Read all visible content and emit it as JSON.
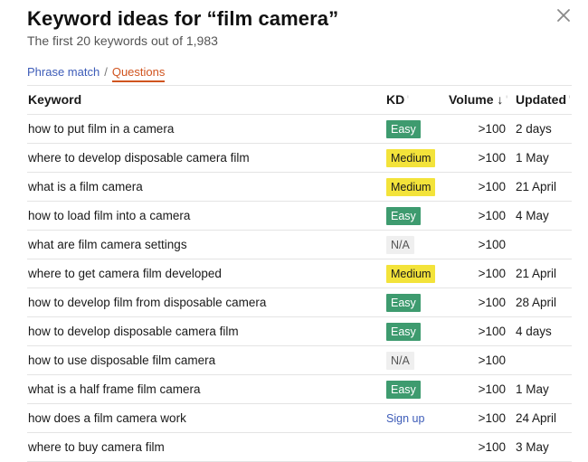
{
  "header": {
    "title": "Keyword ideas for “film camera”",
    "subtitle": "The first 20 keywords out of 1,983"
  },
  "tabs": [
    {
      "label": "Phrase match",
      "active": false
    },
    {
      "label": "Questions",
      "active": true
    }
  ],
  "tab_separator": "/",
  "columns": {
    "keyword": "Keyword",
    "kd": "KD",
    "volume": "Volume",
    "updated": "Updated",
    "info_glyph": "ⁱ",
    "sort_arrow": "↓"
  },
  "icons": {
    "close": "close-icon",
    "info": "info-icon",
    "sort": "arrow-down-icon"
  },
  "colors": {
    "easy": "#3e9b6f",
    "medium": "#f3e33a",
    "na": "#efefef",
    "link": "#3d5cb8",
    "active_tab": "#d0541f"
  },
  "rows": [
    {
      "keyword": "how to put film in a camera",
      "kd": "Easy",
      "kd_type": "easy",
      "volume": ">100",
      "updated": "2 days"
    },
    {
      "keyword": "where to develop disposable camera film",
      "kd": "Medium",
      "kd_type": "medium",
      "volume": ">100",
      "updated": "1 May"
    },
    {
      "keyword": "what is a film camera",
      "kd": "Medium",
      "kd_type": "medium",
      "volume": ">100",
      "updated": "21 April"
    },
    {
      "keyword": "how to load film into a camera",
      "kd": "Easy",
      "kd_type": "easy",
      "volume": ">100",
      "updated": "4 May"
    },
    {
      "keyword": "what are film camera settings",
      "kd": "N/A",
      "kd_type": "na",
      "volume": ">100",
      "updated": ""
    },
    {
      "keyword": "where to get camera film developed",
      "kd": "Medium",
      "kd_type": "medium",
      "volume": ">100",
      "updated": "21 April"
    },
    {
      "keyword": "how to develop film from disposable camera",
      "kd": "Easy",
      "kd_type": "easy",
      "volume": ">100",
      "updated": "28 April"
    },
    {
      "keyword": "how to develop disposable camera film",
      "kd": "Easy",
      "kd_type": "easy",
      "volume": ">100",
      "updated": "4 days"
    },
    {
      "keyword": "how to use disposable film camera",
      "kd": "N/A",
      "kd_type": "na",
      "volume": ">100",
      "updated": ""
    },
    {
      "keyword": "what is a half frame film camera",
      "kd": "Easy",
      "kd_type": "easy",
      "volume": ">100",
      "updated": "1 May"
    },
    {
      "keyword": "how does a film camera work",
      "kd": "Sign up",
      "kd_type": "signup",
      "volume": ">100",
      "updated": "24 April"
    },
    {
      "keyword": "where to buy camera film",
      "kd": "",
      "kd_type": "none",
      "volume": ">100",
      "updated": "3 May"
    }
  ]
}
